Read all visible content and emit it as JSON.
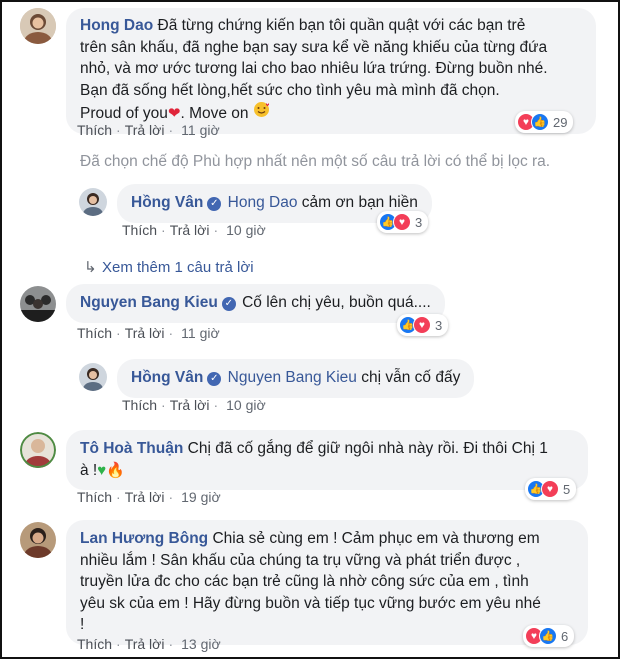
{
  "colors": {
    "link": "#385898",
    "bubble": "#f2f3f5",
    "like": "#1877f2",
    "love": "#f33e58",
    "muted": "#90949c"
  },
  "actions": {
    "like": "Thích",
    "reply": "Trả lời",
    "sep": "·"
  },
  "filter_note": "Đã chọn chế độ Phù hợp nhất nên một số câu trả lời có thể bị lọc ra.",
  "view_more": "Xem thêm 1 câu trả lời",
  "comments": [
    {
      "author": "Hong Dao",
      "lines": [
        "Đã từng chứng kiến bạn tôi quần quật với các bạn trẻ",
        "trên sân khấu, đã nghe bạn say sưa kể về năng khiếu của từng đứa",
        "nhỏ, và mơ ước tương lai cho bao nhiêu lứa trứng. Đừng buồn nhé.",
        "Bạn đã sống hết lòng,hết sức cho tình yêu mà mình đã chọn."
      ],
      "last_line_a": "Proud of you",
      "last_line_b": ". Move on",
      "time": "11 giờ",
      "reactions": "29",
      "reaction_icons": [
        "love-icon",
        "like-icon"
      ]
    },
    {
      "author": "Hồng Vân",
      "tag": "Hong Dao",
      "text": "cảm ơn bạn hiền",
      "time": "10 giờ",
      "reactions": "3",
      "reaction_icons": [
        "like-icon",
        "love-icon"
      ]
    },
    {
      "author": "Nguyen Bang Kieu",
      "text": "Cố lên chị yêu, buồn quá....",
      "time": "11 giờ",
      "reactions": "3",
      "reaction_icons": [
        "like-icon",
        "love-icon"
      ]
    },
    {
      "author": "Hồng Vân",
      "tag": "Nguyen Bang Kieu",
      "text": "chị vẫn cố đấy",
      "time": "10 giờ"
    },
    {
      "author": "Tô Hoà Thuận",
      "line1": "Chị đã cố gắng để giữ ngôi nhà này rồi. Đi thôi Chị 1",
      "line2": "à !",
      "time": "19 giờ",
      "reactions": "5",
      "reaction_icons": [
        "like-icon",
        "love-icon"
      ]
    },
    {
      "author": "Lan Hương Bông",
      "lines": [
        "Chia sẻ cùng em ! Cảm phục em và thương em",
        "nhiều lắm ! Sân khấu của chúng ta trụ vững và phát triển được ,",
        "truyền lửa đc cho các bạn trẻ cũng là nhờ công sức của em , tình",
        "yêu sk của em ! Hãy đừng buồn và tiếp tục vững bước em yêu nhé",
        "!"
      ],
      "time": "13 giờ",
      "reactions": "6",
      "reaction_icons": [
        "love-icon",
        "like-icon"
      ]
    }
  ]
}
